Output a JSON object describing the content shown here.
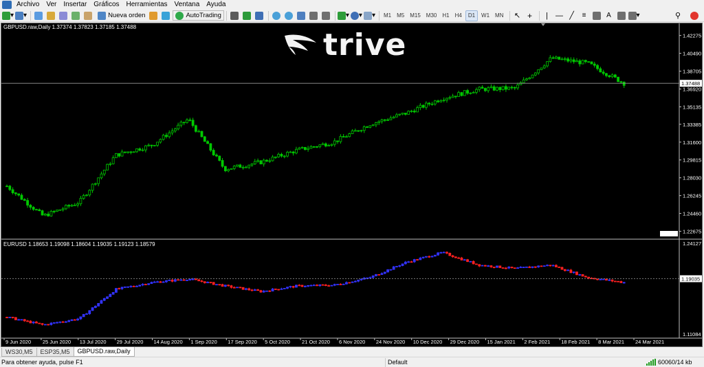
{
  "menu": [
    "Archivo",
    "Ver",
    "Insertar",
    "Gráficos",
    "Herramientas",
    "Ventana",
    "Ayuda"
  ],
  "toolbar": {
    "new_order": "Nueva orden",
    "autotrading": "AutoTrading",
    "timeframes": [
      "M1",
      "M5",
      "M15",
      "M30",
      "H1",
      "H4",
      "D1",
      "W1",
      "MN"
    ],
    "active_timeframe": "D1"
  },
  "logo_text": "trive",
  "main_chart": {
    "title": "GBPUSD.raw,Daily  1.37374 1.37823 1.37185 1.37488",
    "y_ticks": [
      "1.42275",
      "1.40490",
      "1.38705",
      "1.36920",
      "1.35135",
      "1.33385",
      "1.31600",
      "1.29815",
      "1.28030",
      "1.26245",
      "1.24460",
      "1.22675"
    ],
    "current_price": "1.37488",
    "colors": {
      "up": "#00c800",
      "down": "#00c800",
      "wick": "#00c800"
    }
  },
  "sub_chart": {
    "title": "EURUSD 1.18653 1.19098 1.18604 1.19035 1.19123 1.18579",
    "y_ticks": [
      "1.24127",
      "1.11084"
    ],
    "current_price": "1.19035",
    "colors": {
      "up": "#3333ff",
      "down": "#ff2020"
    }
  },
  "x_ticks": [
    "9 Jun 2020",
    "25 Jun 2020",
    "13 Jul 2020",
    "29 Jul 2020",
    "14 Aug 2020",
    "1 Sep 2020",
    "17 Sep 2020",
    "5 Oct 2020",
    "21 Oct 2020",
    "6 Nov 2020",
    "24 Nov 2020",
    "10 Dec 2020",
    "29 Dec 2020",
    "15 Jan 2021",
    "2 Feb 2021",
    "18 Feb 2021",
    "8 Mar 2021",
    "24 Mar 2021"
  ],
  "chart_data": [
    {
      "type": "candlestick",
      "title": "GBPUSD.raw,Daily",
      "ylim": [
        1.2216,
        1.428
      ],
      "x": [
        "9 Jun 2020",
        "25 Jun 2020",
        "13 Jul 2020",
        "29 Jul 2020",
        "14 Aug 2020",
        "1 Sep 2020",
        "17 Sep 2020",
        "5 Oct 2020",
        "21 Oct 2020",
        "6 Nov 2020",
        "24 Nov 2020",
        "10 Dec 2020",
        "29 Dec 2020",
        "15 Jan 2021",
        "2 Feb 2021",
        "18 Feb 2021",
        "8 Mar 2021",
        "24 Mar 2021"
      ],
      "close": [
        1.272,
        1.242,
        1.256,
        1.303,
        1.313,
        1.339,
        1.289,
        1.296,
        1.308,
        1.316,
        1.334,
        1.345,
        1.36,
        1.369,
        1.37,
        1.4,
        1.395,
        1.375
      ]
    },
    {
      "type": "candlestick",
      "title": "EURUSD",
      "ylim": [
        1.1108,
        1.2413
      ],
      "x": [
        "9 Jun 2020",
        "25 Jun 2020",
        "13 Jul 2020",
        "29 Jul 2020",
        "14 Aug 2020",
        "1 Sep 2020",
        "17 Sep 2020",
        "5 Oct 2020",
        "21 Oct 2020",
        "6 Nov 2020",
        "24 Nov 2020",
        "10 Dec 2020",
        "29 Dec 2020",
        "15 Jan 2021",
        "2 Feb 2021",
        "18 Feb 2021",
        "8 Mar 2021",
        "24 Mar 2021"
      ],
      "close": [
        1.135,
        1.124,
        1.133,
        1.175,
        1.185,
        1.19,
        1.18,
        1.172,
        1.18,
        1.181,
        1.192,
        1.214,
        1.228,
        1.21,
        1.205,
        1.21,
        1.192,
        1.185
      ]
    }
  ],
  "tabs": [
    "WS30,M5",
    "ESP35,M5",
    "GBPUSD.raw,Daily"
  ],
  "active_tab": "GBPUSD.raw,Daily",
  "status": {
    "help": "Para obtener ayuda, pulse F1",
    "profile": "Default",
    "traffic": "60060/14 kb"
  }
}
